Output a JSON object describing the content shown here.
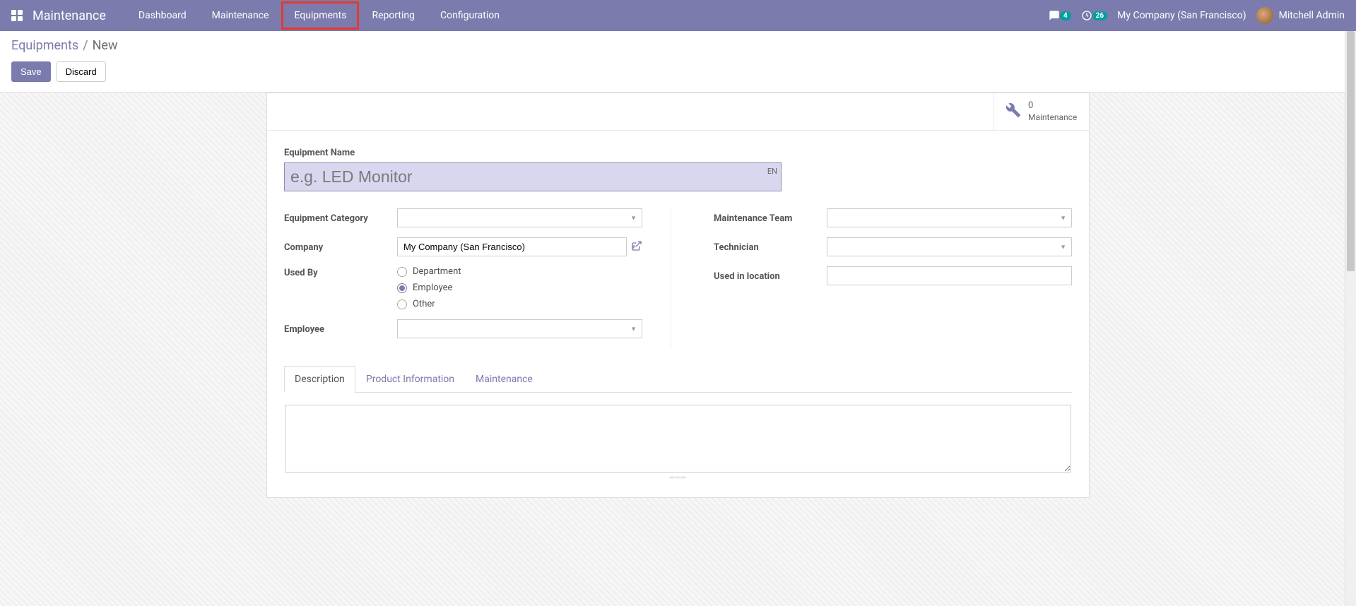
{
  "navbar": {
    "app_title": "Maintenance",
    "menu": [
      "Dashboard",
      "Maintenance",
      "Equipments",
      "Reporting",
      "Configuration"
    ],
    "highlighted_index": 2,
    "messages_count": "4",
    "activities_count": "26",
    "company": "My Company (San Francisco)",
    "username": "Mitchell Admin"
  },
  "breadcrumb": {
    "parent": "Equipments",
    "sep": "/",
    "current": "New"
  },
  "buttons": {
    "save": "Save",
    "discard": "Discard"
  },
  "stat": {
    "count": "0",
    "label": "Maintenance"
  },
  "form": {
    "title_label": "Equipment Name",
    "title_placeholder": "e.g. LED Monitor",
    "title_value": "",
    "lang": "EN",
    "left": {
      "equipment_category_label": "Equipment Category",
      "equipment_category_value": "",
      "company_label": "Company",
      "company_value": "My Company (San Francisco)",
      "used_by_label": "Used By",
      "used_by_options": [
        "Department",
        "Employee",
        "Other"
      ],
      "used_by_selected_index": 1,
      "employee_label": "Employee",
      "employee_value": ""
    },
    "right": {
      "maintenance_team_label": "Maintenance Team",
      "maintenance_team_value": "",
      "technician_label": "Technician",
      "technician_value": "",
      "used_in_location_label": "Used in location",
      "used_in_location_value": ""
    }
  },
  "tabs": [
    "Description",
    "Product Information",
    "Maintenance"
  ],
  "active_tab_index": 0,
  "description_value": ""
}
